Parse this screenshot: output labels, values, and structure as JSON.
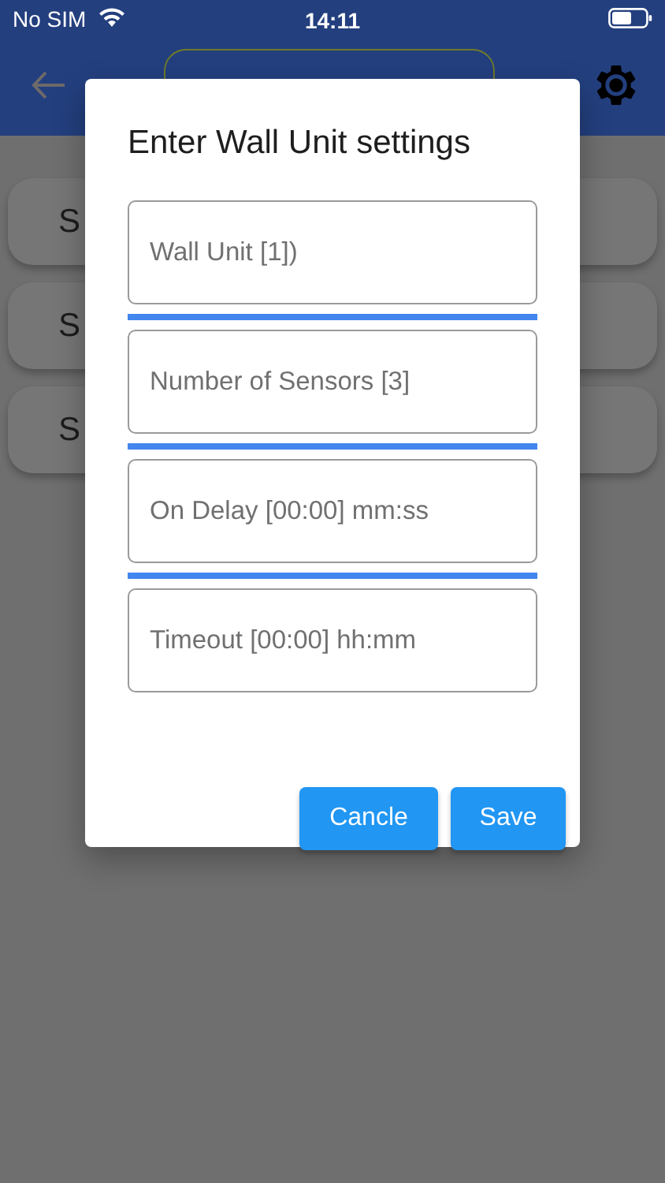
{
  "status_bar": {
    "carrier": "No SIM",
    "time": "14:11"
  },
  "background_cards": [
    {
      "label": "S"
    },
    {
      "label": "S"
    },
    {
      "label": "S"
    }
  ],
  "dialog": {
    "title": "Enter Wall Unit settings",
    "fields": [
      {
        "placeholder": "Wall Unit [1])"
      },
      {
        "placeholder": "Number of Sensors [3]"
      },
      {
        "placeholder": "On Delay [00:00] mm:ss"
      },
      {
        "placeholder": "Timeout [00:00] hh:mm"
      }
    ],
    "buttons": [
      "Cancle",
      "Save"
    ]
  }
}
